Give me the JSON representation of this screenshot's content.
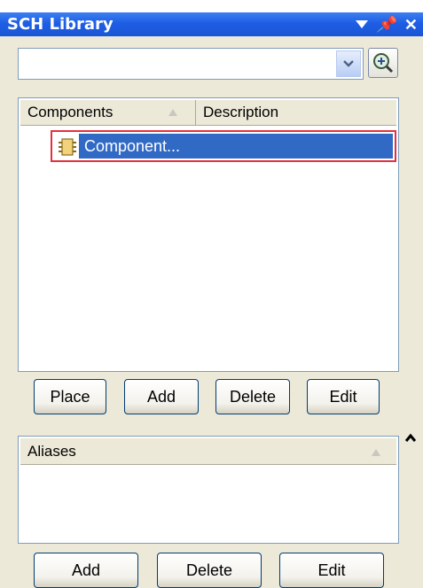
{
  "window": {
    "title": "SCH Library"
  },
  "combo": {
    "value": ""
  },
  "components_list": {
    "columns": [
      "Components",
      "Description"
    ],
    "rows": [
      {
        "name": "Component...",
        "description": "",
        "selected": true
      }
    ]
  },
  "component_buttons": {
    "place": "Place",
    "add": "Add",
    "delete": "Delete",
    "edit": "Edit"
  },
  "aliases": {
    "header": "Aliases"
  },
  "alias_buttons": {
    "add": "Add",
    "delete": "Delete",
    "edit": "Edit"
  },
  "colors": {
    "titlebar": "#1e5ee4",
    "selection": "#316ac5",
    "selection_outline": "#e4303c",
    "panel_bg": "#ece9d8"
  }
}
